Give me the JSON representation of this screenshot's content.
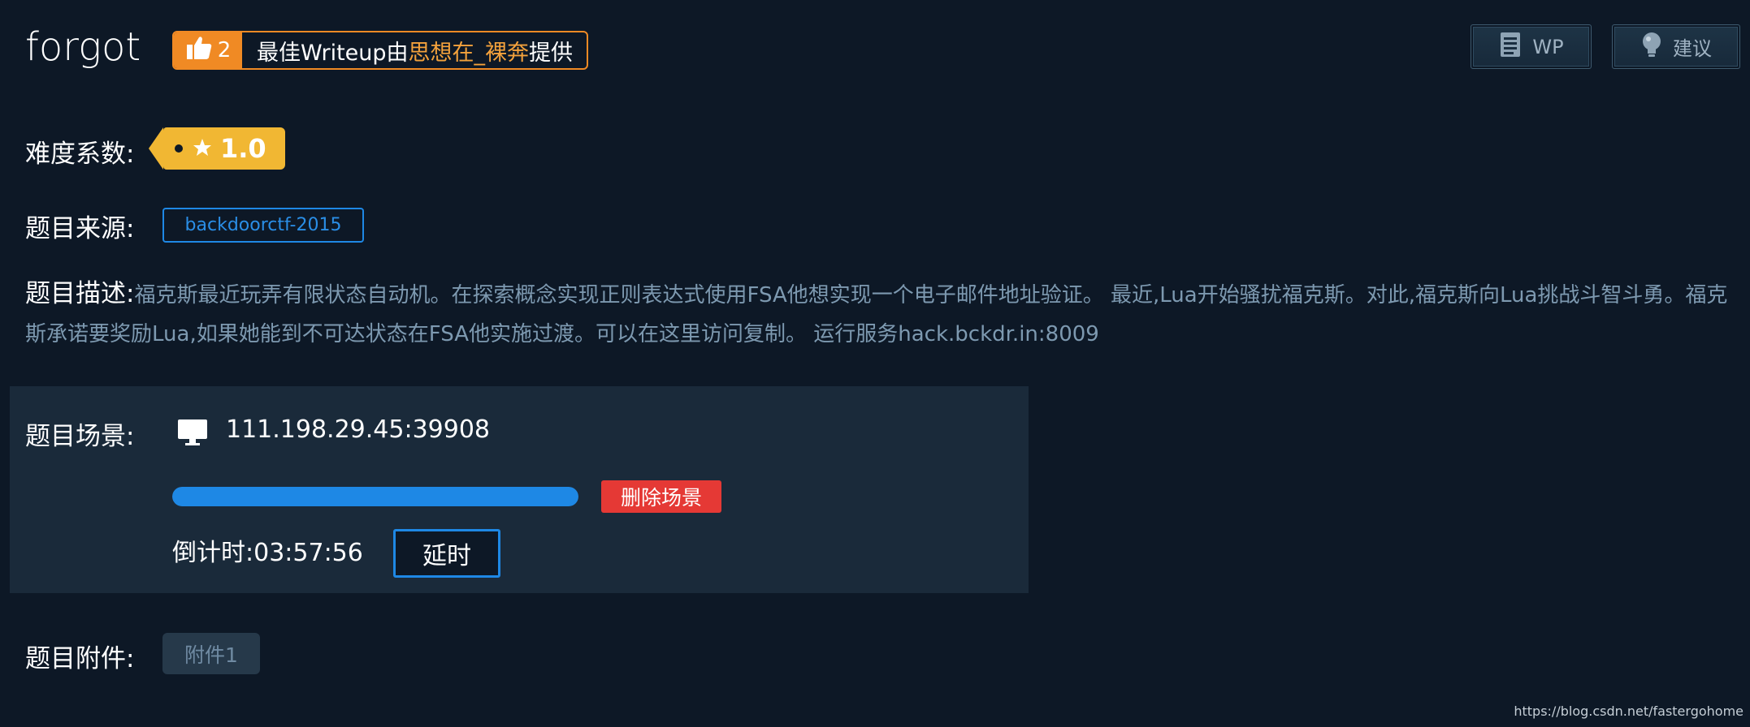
{
  "header": {
    "title": "forgot",
    "writeup": {
      "like_count": "2",
      "prefix": "最佳Writeup由",
      "author": "思想在_裸奔",
      "suffix": "提供"
    },
    "buttons": {
      "wp_label": "WP",
      "wp_icon": "document-icon",
      "suggest_label": "建议",
      "suggest_icon": "lightbulb-icon"
    }
  },
  "difficulty": {
    "label": "难度系数:",
    "value": "1.0",
    "icon": "star-icon"
  },
  "source": {
    "label": "题目来源:",
    "value": "backdoorctf-2015"
  },
  "description": {
    "label": "题目描述:",
    "text": "福克斯最近玩弄有限状态自动机。在探索概念实现正则表达式使用FSA他想实现一个电子邮件地址验证。 最近,Lua开始骚扰福克斯。对此,福克斯向Lua挑战斗智斗勇。福克斯承诺要奖励Lua,如果她能到不可达状态在FSA他实施过渡。可以在这里访问复制。 运行服务hack.bckdr.in:8009"
  },
  "scene": {
    "label": "题目场景:",
    "address": "111.198.29.45:39908",
    "progress_fraction": 1.0,
    "delete_label": "删除场景",
    "countdown_label": "倒计时:",
    "countdown_value": "03:57:56",
    "extend_label": "延时"
  },
  "attachment": {
    "label": "题目附件:",
    "button_label": "附件1"
  },
  "watermark": "https://blog.csdn.net/fastergohome",
  "colors": {
    "background": "#0d1826",
    "panel": "#1a2a3a",
    "accent_blue": "#1e88e5",
    "orange": "#f08a24",
    "star_gold": "#f1b733",
    "danger": "#e53935",
    "muted_text": "#7d99b0"
  }
}
